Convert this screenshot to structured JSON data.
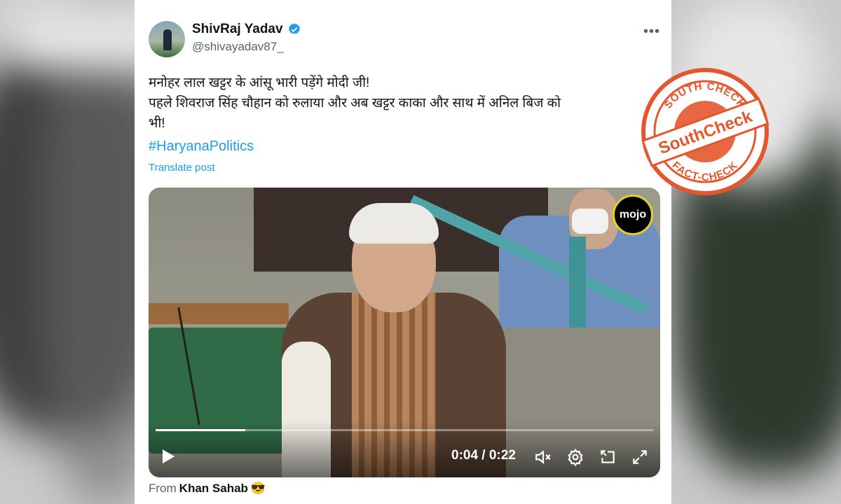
{
  "post": {
    "author_name": "ShivRaj Yadav",
    "author_handle": "@shivayadav87_",
    "more_label": "•••",
    "text_lines": [
      "मनोहर लाल खट्टर के आंसू भारी पड़ेंगे मोदी जी!",
      "पहले शिवराज सिंह चौहान को रुलाया और अब खट्टर काका और साथ में अनिल बिज को",
      "भी!"
    ],
    "hashtag": "#HaryanaPolitics",
    "translate_label": "Translate post"
  },
  "video": {
    "overlay_logo": "mojo",
    "time_display": "0:04 / 0:22",
    "progress": 0.18
  },
  "attribution": {
    "prefix": "From",
    "name": "Khan Sahab",
    "emoji": "😎"
  },
  "stamp": {
    "top_text": "SOUTH CHECK",
    "bottom_text": "FACT-CHECK",
    "brand": "SouthCheck"
  },
  "colors": {
    "link": "#1d9bf0",
    "stamp": "#e4572e"
  }
}
